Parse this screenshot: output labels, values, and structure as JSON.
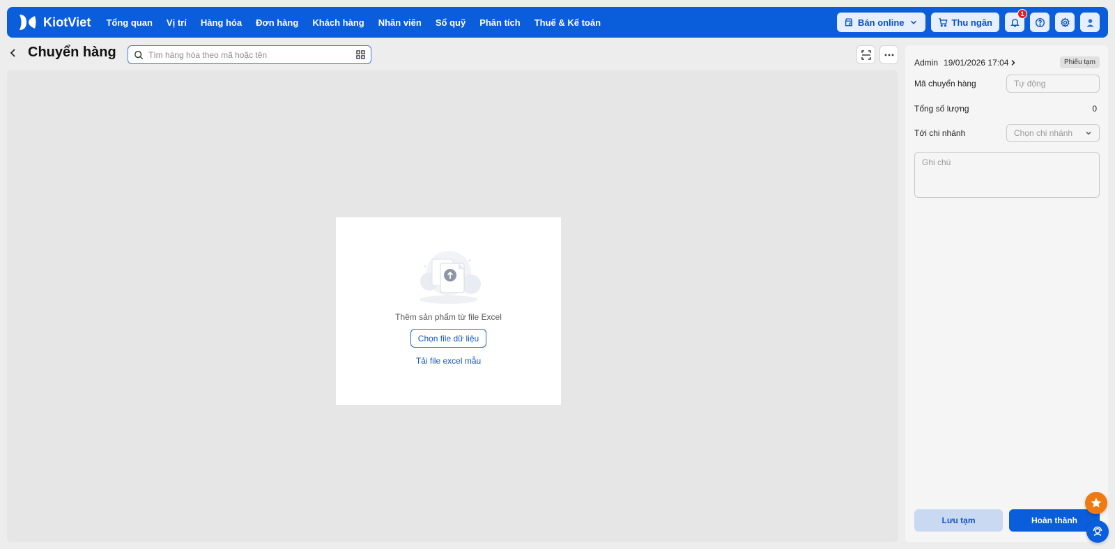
{
  "app": {
    "brand": "KiotViet",
    "brand_color": "#0a5ddb",
    "logo_icon": "kiotviet-logo-icon"
  },
  "nav": {
    "items": [
      {
        "label": "Tổng quan"
      },
      {
        "label": "Vị trí"
      },
      {
        "label": "Hàng hóa"
      },
      {
        "label": "Đơn hàng"
      },
      {
        "label": "Khách hàng"
      },
      {
        "label": "Nhân viên"
      },
      {
        "label": "Sổ quỹ"
      },
      {
        "label": "Phân tích"
      },
      {
        "label": "Thuế & Kế toán"
      }
    ],
    "online_sales_label": "Bán online",
    "cashier_label": "Thu ngân",
    "notification_count": "1",
    "icons": [
      "shop-icon",
      "cart-icon",
      "bell-icon",
      "help-icon",
      "gear-icon",
      "user-avatar-icon"
    ]
  },
  "header": {
    "title": "Chuyển hàng",
    "search_placeholder": "Tìm hàng hóa theo mã hoặc tên",
    "icons": [
      "back-arrow-icon",
      "search-icon",
      "qr-grid-icon",
      "scan-icon",
      "more-icon"
    ]
  },
  "import": {
    "title": "Thêm sản phẩm từ file Excel",
    "choose_file_label": "Chọn file dữ liệu",
    "download_template_label": "Tải file excel mẫu",
    "illustration_icon": "cloud-upload-illustration"
  },
  "panel": {
    "user": "Admin",
    "datetime": "19/01/2026 17:04",
    "status_badge": "Phiếu tạm",
    "code_label": "Mã chuyển hàng",
    "code_placeholder": "Tự động",
    "total_qty_label": "Tổng số lượng",
    "total_qty_value": "0",
    "branch_label": "Tới chi nhánh",
    "branch_placeholder": "Chọn chi nhánh",
    "note_placeholder": "Ghi chú",
    "save_draft_label": "Lưu tạm",
    "complete_label": "Hoàn thành"
  },
  "colors": {
    "primary": "#0a5ddb",
    "badge_red": "#e02020",
    "fab_orange": "#f07a12"
  }
}
